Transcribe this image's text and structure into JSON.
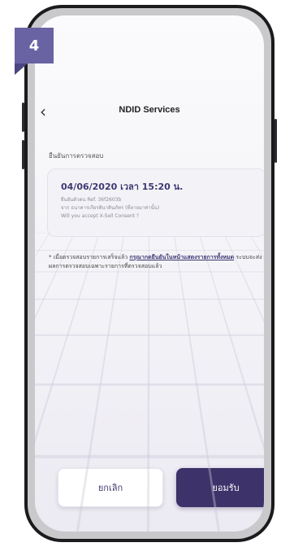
{
  "step": {
    "number": "4"
  },
  "header": {
    "title": "NDID Services",
    "back_icon": "‹"
  },
  "section": {
    "label": "ยืนยันการตรวจสอบ"
  },
  "card": {
    "datetime": "04/06/2020 เวลา 15:20 น.",
    "ref_line": "ยืนยันตัวตน Ref. 36f2603b",
    "from_line": "จาก ธนาคารเกียรตินาคินภัทร (ที่ลายมาท่านั้น)",
    "consent_line": "Will you accept X-Sell Consent ?"
  },
  "note": {
    "prefix": "* เมื่อตรวจสอบรายการเสร็จแล้ว ",
    "link": "กรุณากดยืนยันในหน้าแสดงรายการทั้งหมด",
    "suffix": " ระบบจะส่งผลการตรวจสอบเฉพาะรายการที่ตรวจสอบแล้ว"
  },
  "buttons": {
    "cancel": "ยกเลิก",
    "accept": "ยอมรับ"
  },
  "colors": {
    "accent": "#3d3269",
    "badge": "#6a63a3"
  }
}
